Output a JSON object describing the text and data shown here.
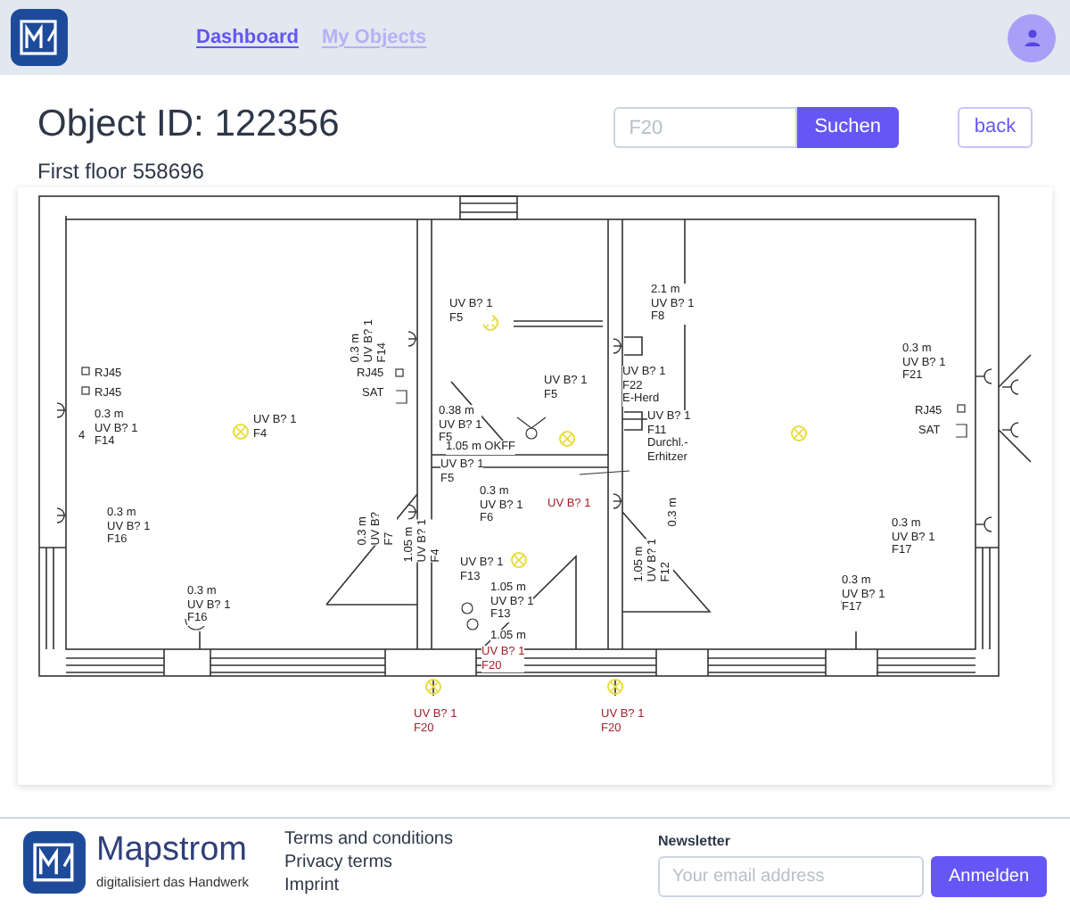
{
  "header": {
    "nav": [
      {
        "label": "Dashboard",
        "selected": true
      },
      {
        "label": "My Objects",
        "selected": false
      }
    ]
  },
  "page": {
    "title": "Object ID: 122356",
    "subtitle": "First floor 558696",
    "search": {
      "placeholder": "F20"
    },
    "search_button": "Suchen",
    "back_button": "back"
  },
  "floor_plan": {
    "labels": [
      {
        "text": "RJ45",
        "color": "#222222"
      },
      {
        "text": "RJ45",
        "color": "#222222"
      },
      {
        "text": "4",
        "color": "#222222"
      },
      {
        "text": "0.3 m\nUV B? 1\nF14",
        "color": "#222222"
      },
      {
        "text": "UV B? 1\nF4",
        "color": "#222222"
      },
      {
        "text": "0.3 m\nUV B? 1\nF16",
        "color": "#222222"
      },
      {
        "text": "0.3 m\nUV B? 1\nF16",
        "color": "#222222"
      },
      {
        "text": "0.3 m\nUV B? 1\nF14",
        "color": "#222222"
      },
      {
        "text": "RJ45",
        "color": "#222222"
      },
      {
        "text": "SAT",
        "color": "#222222"
      },
      {
        "text": "0.3 m\nUV B?\nF7",
        "color": "#222222"
      },
      {
        "text": "1.05 m\nUV B? 1\nF4",
        "color": "#222222"
      },
      {
        "text": "UV B? 1\nF5",
        "color": "#222222"
      },
      {
        "text": "UV B? 1\nF5",
        "color": "#222222"
      },
      {
        "text": "0.38 m\nUV B? 1\nF5",
        "color": "#222222"
      },
      {
        "text": "1.05 m OKFF",
        "color": "#222222"
      },
      {
        "text": "UV B? 1\nF5",
        "color": "#222222"
      },
      {
        "text": "0.3 m\nUV B? 1\nF6",
        "color": "#222222"
      },
      {
        "text": "UV B? 1",
        "color": "#a3202c"
      },
      {
        "text": "UV B? 1\nF13",
        "color": "#222222"
      },
      {
        "text": "1.05 m\nUV B? 1\nF13",
        "color": "#222222"
      },
      {
        "text": "1.05 m",
        "color": "#222222"
      },
      {
        "text": "UV B? 1\nF20",
        "color": "#a3202c"
      },
      {
        "text": "UV B? 1\nF20",
        "color": "#a3202c"
      },
      {
        "text": "UV B? 1\nF20",
        "color": "#a3202c"
      },
      {
        "text": "2.1 m\nUV B? 1\nF8",
        "color": "#222222"
      },
      {
        "text": "UV B? 1\nF22\nE-Herd",
        "color": "#222222"
      },
      {
        "text": "UV B? 1\nF11\nDurchl.-\nErhitzer",
        "color": "#222222"
      },
      {
        "text": "0.3 m",
        "color": "#222222"
      },
      {
        "text": "1.05 m\nUV B? 1\nF12",
        "color": "#222222"
      },
      {
        "text": "0.3 m\nUV B? 1\nF21",
        "color": "#222222"
      },
      {
        "text": "RJ45",
        "color": "#222222"
      },
      {
        "text": "SAT",
        "color": "#222222"
      },
      {
        "text": "0.3 m\nUV B? 1\nF17",
        "color": "#222222"
      },
      {
        "text": "0.3 m\nUV B? 1\nF17",
        "color": "#222222"
      }
    ]
  },
  "footer": {
    "brand": "Mapstrom",
    "tagline": "digitalisiert das Handwerk",
    "links": [
      "Terms and conditions",
      "Privacy terms",
      "Imprint"
    ],
    "newsletter": {
      "label": "Newsletter",
      "placeholder": "Your email address",
      "button": "Anmelden"
    }
  }
}
